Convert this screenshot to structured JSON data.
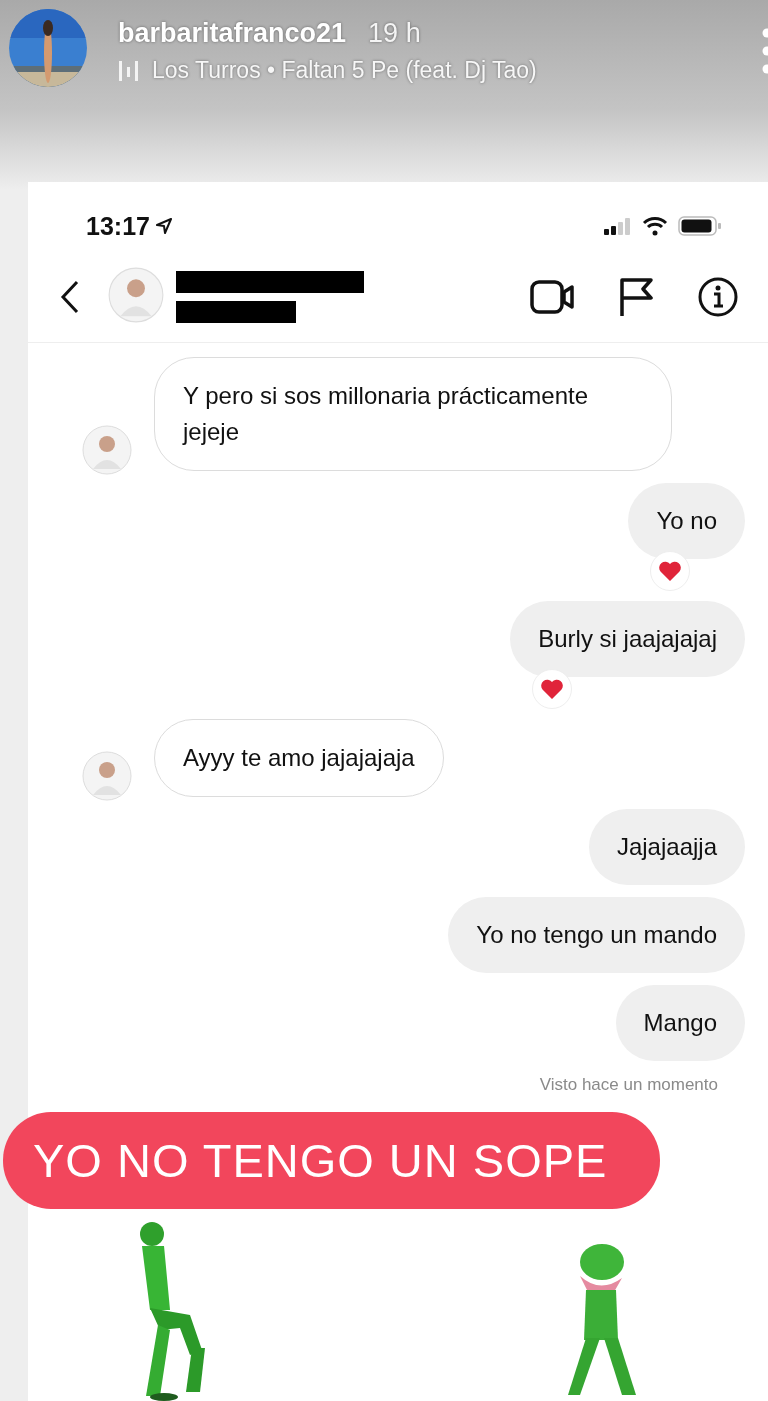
{
  "story": {
    "username": "barbaritafranco21",
    "time": "19 h",
    "music": "Los Turros • Faltan 5 Pe (feat. Dj Tao)"
  },
  "status_bar": {
    "time": "13:17"
  },
  "messages": [
    {
      "kind": "received",
      "text": "Y pero si sos millonaria prácticamente jejeje",
      "reacted": false
    },
    {
      "kind": "sent",
      "text": "Yo no",
      "reacted": true
    },
    {
      "kind": "sent",
      "text": "Burly si jaajajajaj",
      "reacted": true
    },
    {
      "kind": "received",
      "text": "Ayyy te amo jajajajaja",
      "reacted": false
    },
    {
      "kind": "sent",
      "text": "Jajajaajja",
      "reacted": false
    },
    {
      "kind": "sent",
      "text": "Yo no tengo un mando",
      "reacted": false
    },
    {
      "kind": "sent",
      "text": "Mango",
      "reacted": false
    }
  ],
  "seen": "Visto hace un momento",
  "sticker": {
    "text": "YO NO TENGO UN SOPE"
  }
}
